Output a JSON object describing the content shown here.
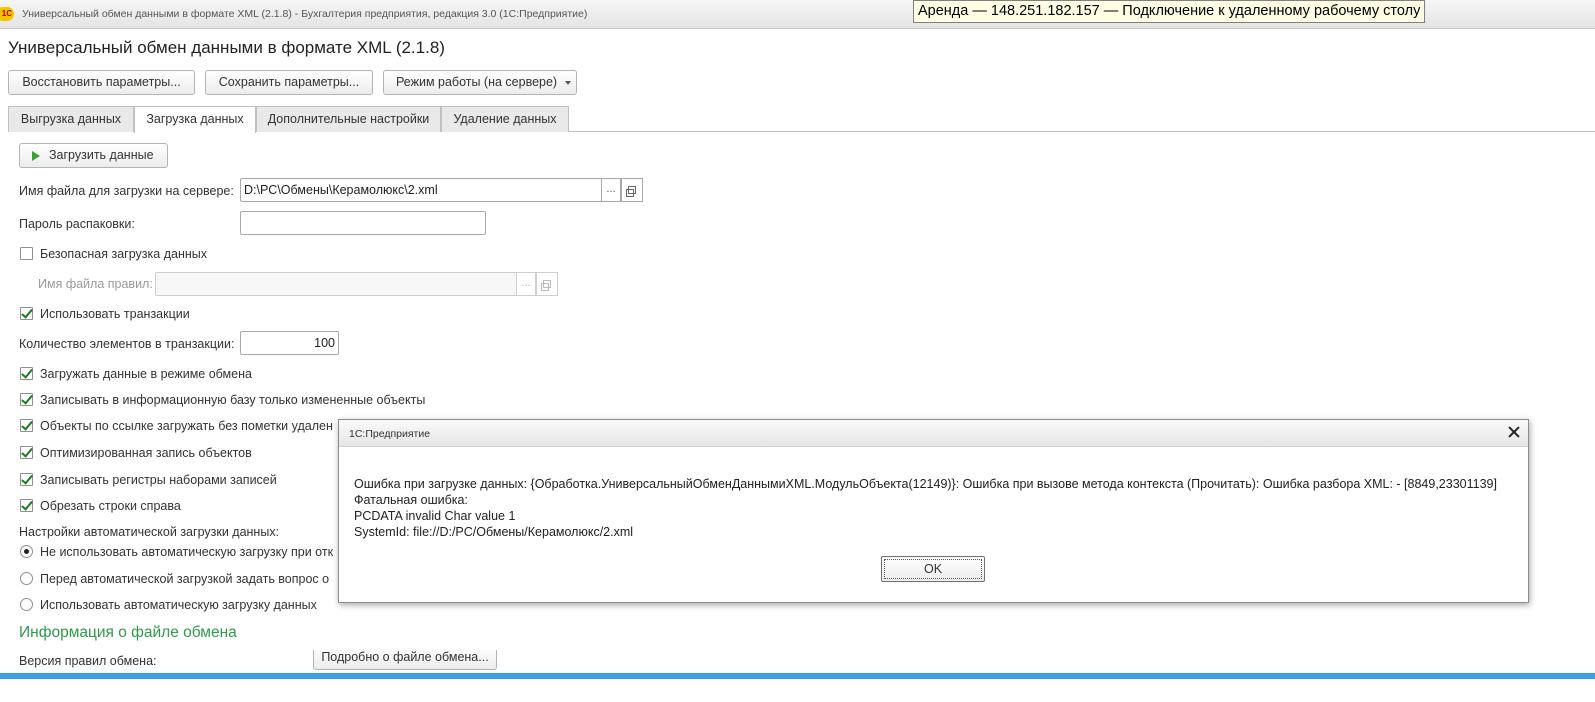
{
  "window": {
    "title": "Универсальный обмен данными в формате XML (2.1.8) - Бухгалтерия предприятия, редакция 3.0  (1С:Предприятие)",
    "logo_text": "1C"
  },
  "rdp_banner": "Аренда — 148.251.182.157 — Подключение к удаленному рабочему столу",
  "page_title": "Универсальный обмен данными в формате XML (2.1.8)",
  "toolbar": {
    "restore_label": "Восстановить параметры...",
    "save_label": "Сохранить параметры...",
    "mode_label": "Режим работы (на сервере)"
  },
  "tabs": [
    {
      "label": "Выгрузка данных",
      "active": false
    },
    {
      "label": "Загрузка данных",
      "active": true
    },
    {
      "label": "Дополнительные настройки",
      "active": false
    },
    {
      "label": "Удаление данных",
      "active": false
    }
  ],
  "load_form": {
    "load_button": "Загрузить данные",
    "file_label": "Имя файла для загрузки на сервере:",
    "file_value": "D:\\PC\\Обмены\\Керамолюкс\\2.xml",
    "select_button": "...",
    "password_label": "Пароль распаковки:",
    "password_value": "",
    "safe_load": {
      "label": "Безопасная загрузка данных",
      "checked": false
    },
    "rules_label": "Имя файла правил:",
    "rules_value": "",
    "use_transactions": {
      "label": "Использовать транзакции",
      "checked": true
    },
    "tx_count_label": "Количество элементов в транзакции:",
    "tx_count_value": "100",
    "exchange_mode": {
      "label": "Загружать данные в режиме обмена",
      "checked": true
    },
    "only_changed": {
      "label": "Записывать в информационную базу только измененные объекты",
      "checked": true
    },
    "by_ref": {
      "label": "Объекты по ссылке загружать без пометки удален",
      "checked": true
    },
    "optimized": {
      "label": "Оптимизированная запись объектов",
      "checked": true
    },
    "registers": {
      "label": "Записывать регистры наборами записей",
      "checked": true
    },
    "trim": {
      "label": "Обрезать строки справа",
      "checked": true
    },
    "auto_settings_label": "Настройки автоматической загрузки данных:",
    "auto_options": [
      {
        "label": "Не использовать автоматическую загрузку при отк",
        "checked": true
      },
      {
        "label": "Перед автоматической загрузкой задать вопрос о",
        "checked": false
      },
      {
        "label": "Использовать автоматическую загрузку данных",
        "checked": false
      }
    ],
    "info_section_title": "Информация о файле обмена",
    "rules_version_label": "Версия правил обмена:",
    "details_button": "Подробно о файле обмена..."
  },
  "dialog": {
    "title": "1С:Предприятие",
    "message_lines": [
      "Ошибка при загрузке данных: {Обработка.УниверсальныйОбменДаннымиXML.МодульОбъекта(12149)}: Ошибка при вызове метода контекста (Прочитать): Ошибка разбора XML:  - [8849,23301139]",
      "Фатальная ошибка:",
      "PCDATA invalid Char value 1",
      "SystemId: file://D:/PC/Обмены/Керамолюкс/2.xml"
    ],
    "ok_label": "OK"
  },
  "colors": {
    "accent_green": "#2e9a4a",
    "bottom_stripe": "#3aa0e0",
    "check_green": "#1f7a1f"
  }
}
